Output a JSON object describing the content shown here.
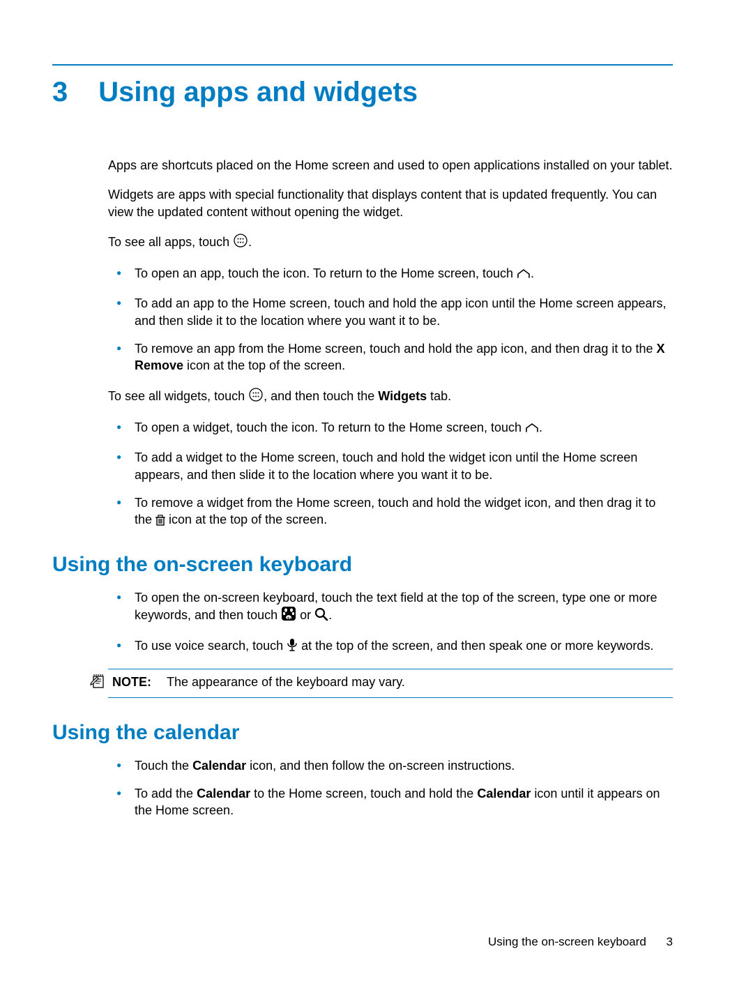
{
  "chapter": {
    "number": "3",
    "title": "Using apps and widgets"
  },
  "intro": {
    "p1": "Apps are shortcuts placed on the Home screen and used to open applications installed on your tablet.",
    "p2": "Widgets are apps with special functionality that displays content that is updated frequently. You can view the updated content without opening the widget.",
    "allapps_pre": "To see all apps, touch ",
    "allapps_post": "."
  },
  "apps_bullets": {
    "b1_pre": "To open an app, touch the icon. To return to the Home screen, touch ",
    "b1_post": ".",
    "b2": "To add an app to the Home screen, touch and hold the app icon until the Home screen appears, and then slide it to the location where you want it to be.",
    "b3_pre": "To remove an app from the Home screen, touch and hold the app icon, and then drag it to the ",
    "b3_bold": "X Remove",
    "b3_post": " icon at the top of the screen."
  },
  "widgets_line": {
    "pre": "To see all widgets, touch ",
    "mid": ", and then touch the ",
    "bold": "Widgets",
    "post": " tab."
  },
  "widgets_bullets": {
    "b1_pre": "To open a widget, touch the icon. To return to the Home screen, touch ",
    "b1_post": ".",
    "b2": "To add a widget to the Home screen, touch and hold the widget icon until the Home screen appears, and then slide it to the location where you want it to be.",
    "b3_pre": "To remove a widget from the Home screen, touch and hold the widget icon, and then drag it to the ",
    "b3_post": " icon at the top of the screen."
  },
  "sec_keyboard": {
    "title": "Using the on-screen keyboard",
    "b1_pre": "To open the on-screen keyboard, touch the text field at the top of the screen, type one or more keywords, and then touch ",
    "b1_mid": " or ",
    "b1_post": ".",
    "b2_pre": "To use voice search, touch ",
    "b2_post": " at the top of the screen, and then speak one or more keywords."
  },
  "note": {
    "label": "NOTE:",
    "text": "The appearance of the keyboard may vary."
  },
  "sec_calendar": {
    "title": "Using the calendar",
    "b1_pre": "Touch the ",
    "b1_bold": "Calendar",
    "b1_post": " icon, and then follow the on-screen instructions.",
    "b2_pre": "To add the ",
    "b2_bold1": "Calendar",
    "b2_mid": " to the Home screen, touch and hold the ",
    "b2_bold2": "Calendar",
    "b2_post": " icon until it appears on the Home screen."
  },
  "footer": {
    "text": "Using the on-screen keyboard",
    "page": "3"
  }
}
